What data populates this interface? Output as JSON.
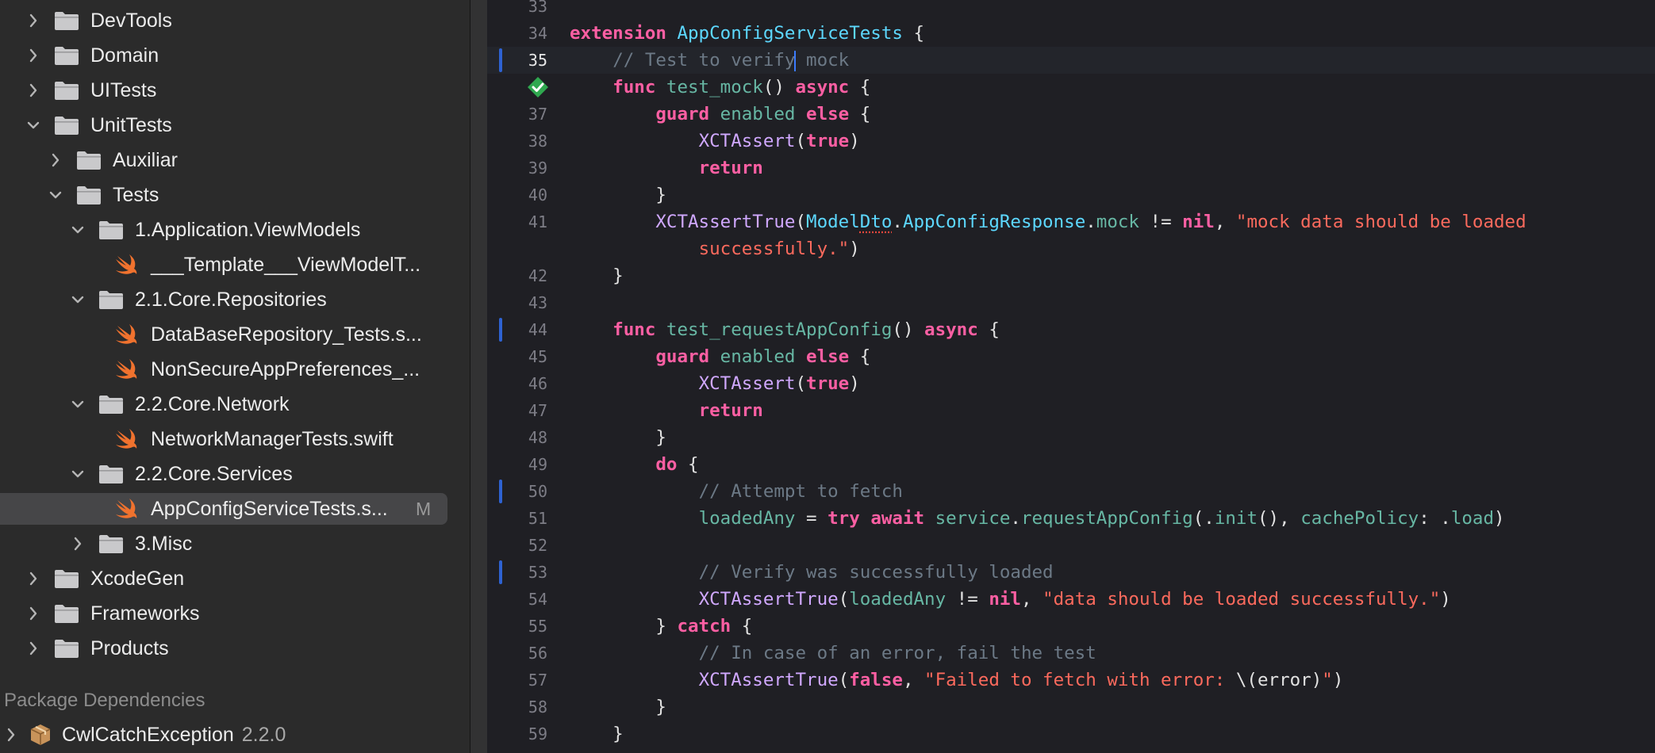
{
  "navigator": {
    "items": [
      {
        "label": "DevTools",
        "kind": "folder",
        "level": 1,
        "expanded": false
      },
      {
        "label": "Domain",
        "kind": "folder",
        "level": 1,
        "expanded": false
      },
      {
        "label": "UITests",
        "kind": "folder",
        "level": 1,
        "expanded": false
      },
      {
        "label": "UnitTests",
        "kind": "folder",
        "level": 1,
        "expanded": true
      },
      {
        "label": "Auxiliar",
        "kind": "folder",
        "level": 2,
        "expanded": false
      },
      {
        "label": "Tests",
        "kind": "folder",
        "level": 2,
        "expanded": true
      },
      {
        "label": "1.Application.ViewModels",
        "kind": "folder",
        "level": 3,
        "expanded": true
      },
      {
        "label": "___Template___ViewModelT...",
        "kind": "swift",
        "level": 4
      },
      {
        "label": "2.1.Core.Repositories",
        "kind": "folder",
        "level": 3,
        "expanded": true
      },
      {
        "label": "DataBaseRepository_Tests.s...",
        "kind": "swift",
        "level": 4
      },
      {
        "label": "NonSecureAppPreferences_...",
        "kind": "swift",
        "level": 4
      },
      {
        "label": "2.2.Core.Network",
        "kind": "folder",
        "level": 3,
        "expanded": true
      },
      {
        "label": "NetworkManagerTests.swift",
        "kind": "swift",
        "level": 4
      },
      {
        "label": "2.2.Core.Services",
        "kind": "folder",
        "level": 3,
        "expanded": true
      },
      {
        "label": "AppConfigServiceTests.s...",
        "kind": "swift",
        "level": 4,
        "selected": true,
        "badge": "M"
      },
      {
        "label": "3.Misc",
        "kind": "folder",
        "level": 3,
        "expanded": false
      },
      {
        "label": "XcodeGen",
        "kind": "folder",
        "level": 1,
        "expanded": false
      },
      {
        "label": "Frameworks",
        "kind": "folder",
        "level": 1,
        "expanded": false
      },
      {
        "label": "Products",
        "kind": "folder",
        "level": 1,
        "expanded": false
      }
    ],
    "package_header": "Package Dependencies",
    "package": {
      "name": "CwlCatchException",
      "version": "2.2.0"
    }
  },
  "editor": {
    "current_line": "35",
    "lines": [
      {
        "n": "33",
        "tokens": []
      },
      {
        "n": "34",
        "tokens": [
          [
            "kw",
            "extension"
          ],
          [
            "tx",
            " "
          ],
          [
            "ty",
            "AppConfigServiceTests"
          ],
          [
            "tx",
            " {"
          ]
        ]
      },
      {
        "n": "35",
        "change": true,
        "tokens": [
          [
            "tx",
            "    "
          ],
          [
            "cm",
            "// Test to verify"
          ],
          [
            "caret",
            ""
          ],
          [
            "cm",
            " mock"
          ]
        ]
      },
      {
        "n": "36",
        "test_passed": true,
        "tokens": [
          [
            "tx",
            "    "
          ],
          [
            "kw",
            "func"
          ],
          [
            "tx",
            " "
          ],
          [
            "fn",
            "test_mock"
          ],
          [
            "tx",
            "() "
          ],
          [
            "kw",
            "async"
          ],
          [
            "tx",
            " {"
          ]
        ]
      },
      {
        "n": "37",
        "tokens": [
          [
            "tx",
            "        "
          ],
          [
            "kw",
            "guard"
          ],
          [
            "tx",
            " "
          ],
          [
            "fn",
            "enabled"
          ],
          [
            "tx",
            " "
          ],
          [
            "kw",
            "else"
          ],
          [
            "tx",
            " {"
          ]
        ]
      },
      {
        "n": "38",
        "tokens": [
          [
            "tx",
            "            "
          ],
          [
            "cl",
            "XCTAssert"
          ],
          [
            "tx",
            "("
          ],
          [
            "kw",
            "true"
          ],
          [
            "tx",
            ")"
          ]
        ]
      },
      {
        "n": "39",
        "tokens": [
          [
            "tx",
            "            "
          ],
          [
            "kw",
            "return"
          ]
        ]
      },
      {
        "n": "40",
        "tokens": [
          [
            "tx",
            "        }"
          ]
        ]
      },
      {
        "n": "41",
        "tokens": [
          [
            "tx",
            "        "
          ],
          [
            "cl",
            "XCTAssertTrue"
          ],
          [
            "tx",
            "("
          ],
          [
            "ty",
            "Model"
          ],
          [
            "squig",
            "Dto"
          ],
          [
            "tx",
            "."
          ],
          [
            "ty",
            "AppConfigResponse"
          ],
          [
            "tx",
            "."
          ],
          [
            "fn",
            "mock"
          ],
          [
            "tx",
            " != "
          ],
          [
            "kw",
            "nil"
          ],
          [
            "tx",
            ", "
          ],
          [
            "st",
            "\"mock data should be loaded"
          ]
        ]
      },
      {
        "n": "",
        "tokens": [
          [
            "tx",
            "            "
          ],
          [
            "st",
            "successfully.\""
          ],
          [
            "tx",
            ")"
          ]
        ]
      },
      {
        "n": "42",
        "tokens": [
          [
            "tx",
            "    }"
          ]
        ]
      },
      {
        "n": "43",
        "tokens": []
      },
      {
        "n": "44",
        "change": true,
        "tokens": [
          [
            "tx",
            "    "
          ],
          [
            "kw",
            "func"
          ],
          [
            "tx",
            " "
          ],
          [
            "fn",
            "test_requestAppConfig"
          ],
          [
            "tx",
            "() "
          ],
          [
            "kw",
            "async"
          ],
          [
            "tx",
            " {"
          ]
        ]
      },
      {
        "n": "45",
        "tokens": [
          [
            "tx",
            "        "
          ],
          [
            "kw",
            "guard"
          ],
          [
            "tx",
            " "
          ],
          [
            "fn",
            "enabled"
          ],
          [
            "tx",
            " "
          ],
          [
            "kw",
            "else"
          ],
          [
            "tx",
            " {"
          ]
        ]
      },
      {
        "n": "46",
        "tokens": [
          [
            "tx",
            "            "
          ],
          [
            "cl",
            "XCTAssert"
          ],
          [
            "tx",
            "("
          ],
          [
            "kw",
            "true"
          ],
          [
            "tx",
            ")"
          ]
        ]
      },
      {
        "n": "47",
        "tokens": [
          [
            "tx",
            "            "
          ],
          [
            "kw",
            "return"
          ]
        ]
      },
      {
        "n": "48",
        "tokens": [
          [
            "tx",
            "        }"
          ]
        ]
      },
      {
        "n": "49",
        "tokens": [
          [
            "tx",
            "        "
          ],
          [
            "kw",
            "do"
          ],
          [
            "tx",
            " {"
          ]
        ]
      },
      {
        "n": "50",
        "change": true,
        "tokens": [
          [
            "tx",
            "            "
          ],
          [
            "cm",
            "// Attempt to fetch"
          ]
        ]
      },
      {
        "n": "51",
        "tokens": [
          [
            "tx",
            "            "
          ],
          [
            "fn",
            "loadedAny"
          ],
          [
            "tx",
            " = "
          ],
          [
            "kw",
            "try"
          ],
          [
            "tx",
            " "
          ],
          [
            "kw",
            "await"
          ],
          [
            "tx",
            " "
          ],
          [
            "fn",
            "service"
          ],
          [
            "tx",
            "."
          ],
          [
            "fn",
            "requestAppConfig"
          ],
          [
            "tx",
            "(."
          ],
          [
            "fn",
            "init"
          ],
          [
            "tx",
            "(), "
          ],
          [
            "fn",
            "cachePolicy"
          ],
          [
            "tx",
            ": ."
          ],
          [
            "fn",
            "load"
          ],
          [
            "tx",
            ")"
          ]
        ]
      },
      {
        "n": "52",
        "tokens": []
      },
      {
        "n": "53",
        "change": true,
        "tokens": [
          [
            "tx",
            "            "
          ],
          [
            "cm",
            "// Verify was successfully loaded"
          ]
        ]
      },
      {
        "n": "54",
        "tokens": [
          [
            "tx",
            "            "
          ],
          [
            "cl",
            "XCTAssertTrue"
          ],
          [
            "tx",
            "("
          ],
          [
            "fn",
            "loadedAny"
          ],
          [
            "tx",
            " != "
          ],
          [
            "kw",
            "nil"
          ],
          [
            "tx",
            ", "
          ],
          [
            "st",
            "\"data should be loaded successfully.\""
          ],
          [
            "tx",
            ")"
          ]
        ]
      },
      {
        "n": "55",
        "tokens": [
          [
            "tx",
            "        } "
          ],
          [
            "kw",
            "catch"
          ],
          [
            "tx",
            " {"
          ]
        ]
      },
      {
        "n": "56",
        "tokens": [
          [
            "tx",
            "            "
          ],
          [
            "cm",
            "// In case of an error, fail the test"
          ]
        ]
      },
      {
        "n": "57",
        "tokens": [
          [
            "tx",
            "            "
          ],
          [
            "cl",
            "XCTAssertTrue"
          ],
          [
            "tx",
            "("
          ],
          [
            "kw",
            "false"
          ],
          [
            "tx",
            ", "
          ],
          [
            "st",
            "\"Failed to fetch with error: "
          ],
          [
            "tx",
            "\\(error)"
          ],
          [
            "st",
            "\""
          ],
          [
            "tx",
            ")"
          ]
        ]
      },
      {
        "n": "58",
        "tokens": [
          [
            "tx",
            "        }"
          ]
        ]
      },
      {
        "n": "59",
        "tokens": [
          [
            "tx",
            "    }"
          ]
        ]
      },
      {
        "n": "",
        "tokens": [
          [
            "tx",
            "}"
          ]
        ]
      }
    ]
  },
  "colors": {
    "keyword": "#fc5fa3",
    "type": "#5dd8ff",
    "identifier": "#67b7a4",
    "xct_call": "#d0a8ff",
    "string": "#fc6a5d",
    "comment": "#6c7986",
    "change_bar": "#2e62d2",
    "test_pass": "#2fa84f",
    "swift_icon": "#f0722e"
  }
}
